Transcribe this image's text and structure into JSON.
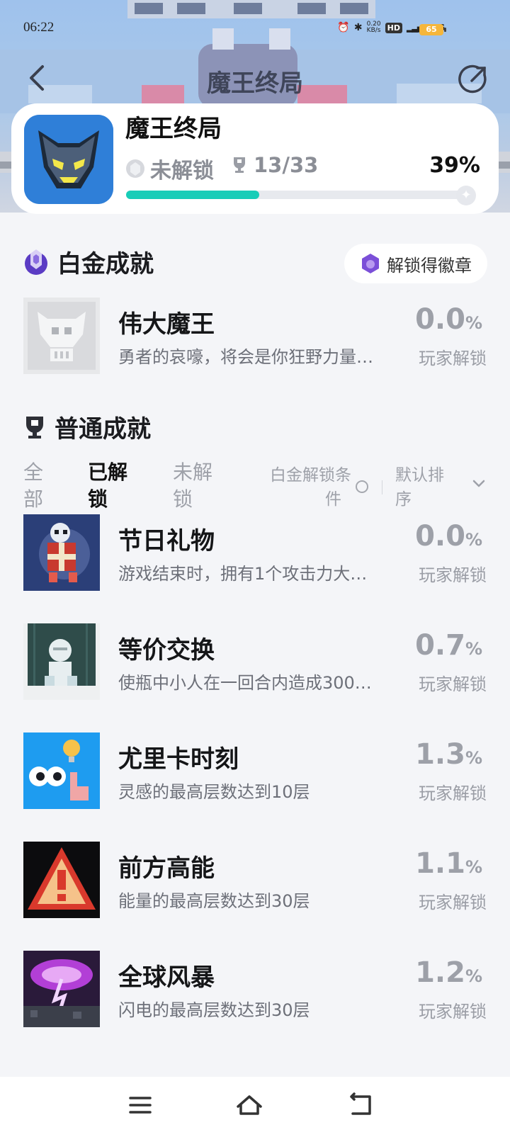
{
  "status_bar": {
    "time": "06:22",
    "net_speed_value": "0.20",
    "net_speed_unit": "KB/s",
    "hd_label": "HD",
    "signal_label": "4G",
    "battery": "65"
  },
  "header": {
    "title": "魔王终局",
    "back_icon": "chevron-left-icon",
    "share_icon": "share-icon"
  },
  "game": {
    "title": "魔王终局",
    "lock_state": "未解锁",
    "trophy_count": "13/33",
    "percent": "39%",
    "progress": 0.39
  },
  "platinum": {
    "title": "白金成就",
    "badge_button": "解锁得徽章",
    "item": {
      "name": "伟大魔王",
      "desc": "勇者的哀嚎，将会是你狂野力量…",
      "pct": "0.0",
      "pct_unit": "%",
      "sub": "玩家解锁"
    }
  },
  "normal": {
    "title": "普通成就",
    "filters": {
      "all_line1": "全",
      "all_line2": "部",
      "unlocked_line1": "已解",
      "unlocked_line2": "锁",
      "locked_line1": "未解",
      "locked_line2": "锁",
      "condition_line1": "白金解锁条",
      "condition_line2": "件",
      "sort_line1": "默认排",
      "sort_line2": "序"
    },
    "items": [
      {
        "name": "节日礼物",
        "desc": "游戏结束时，拥有1个攻击力大…",
        "pct": "0.0",
        "pct_unit": "%",
        "sub": "玩家解锁"
      },
      {
        "name": "等价交换",
        "desc": "使瓶中小人在一回合内造成300…",
        "pct": "0.7",
        "pct_unit": "%",
        "sub": "玩家解锁"
      },
      {
        "name": "尤里卡时刻",
        "desc": "灵感的最高层数达到10层",
        "pct": "1.3",
        "pct_unit": "%",
        "sub": "玩家解锁"
      },
      {
        "name": "前方高能",
        "desc": "能量的最高层数达到30层",
        "pct": "1.1",
        "pct_unit": "%",
        "sub": "玩家解锁"
      },
      {
        "name": "全球风暴",
        "desc": "闪电的最高层数达到30层",
        "pct": "1.2",
        "pct_unit": "%",
        "sub": "玩家解锁"
      }
    ]
  },
  "colors": {
    "accent": "#18cdb8",
    "background": "#f4f5f8",
    "muted": "#9da0a8"
  }
}
